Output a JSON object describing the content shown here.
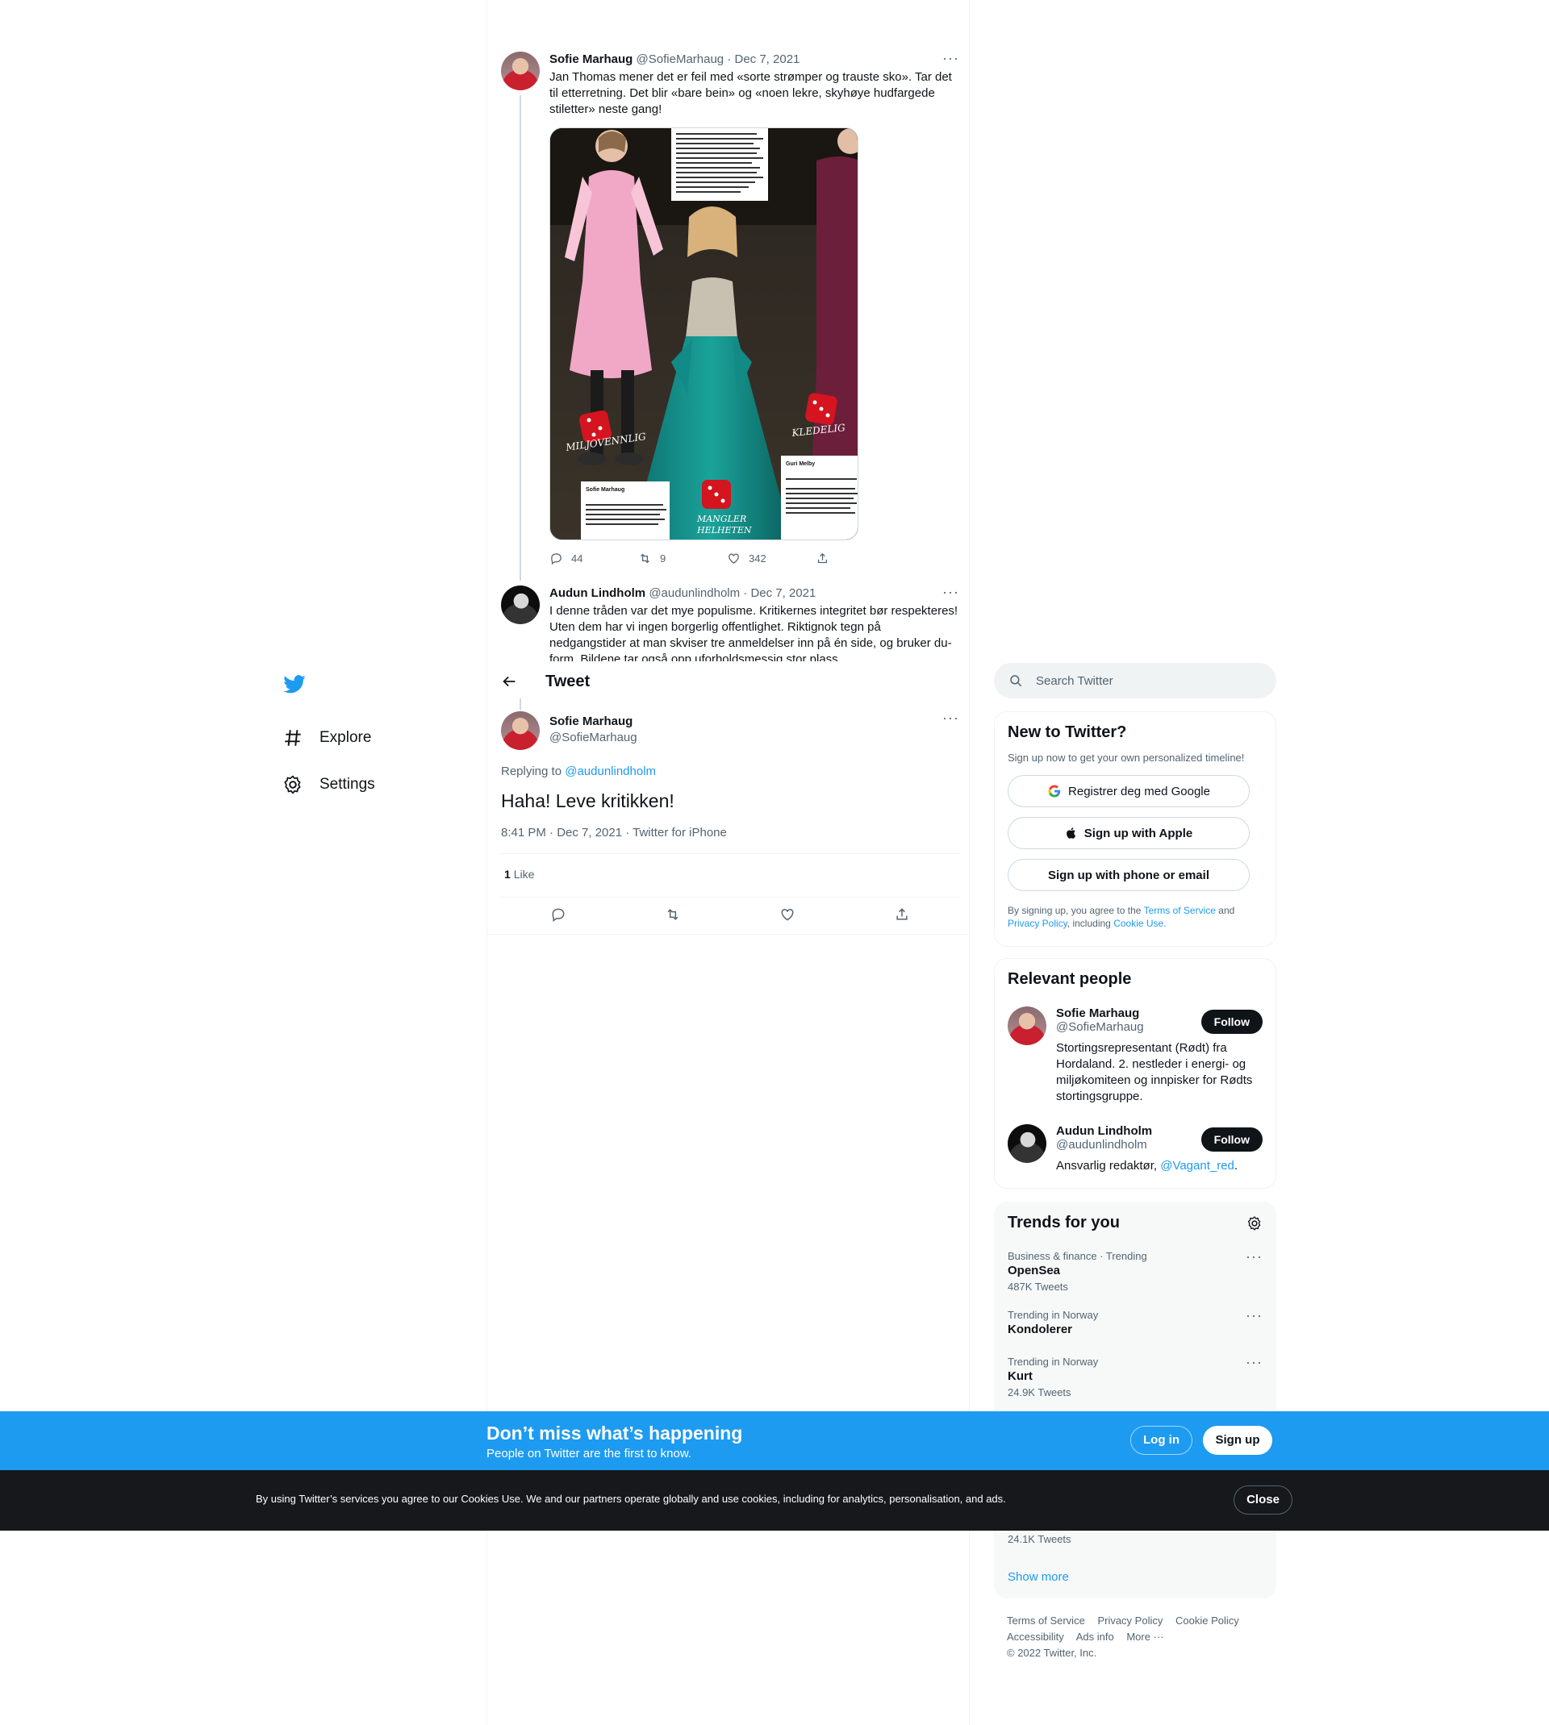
{
  "thread": {
    "tweet1": {
      "name": "Sofie Marhaug",
      "handle": "@SofieMarhaug",
      "date": "· Dec 7, 2021",
      "text": "Jan Thomas mener det er feil med «sorte strømper og trauste sko». Tar det til etterretning. Det blir «bare bein» og «noen lekre, skyhøye hudfargede stiletter» neste gang!",
      "replies": "44",
      "retweets": "9",
      "likes": "342",
      "media": {
        "box_text": "Dette er en litt underlig kjole. Den minner meg dessverre litt for mye om et kostyme. Den øvre delen ser nærmest ut som en BH, og så har du et skjørt nedentil. Det er ingen helhet i dette antrekket. Du er jo eventyrlig vakker, og du ville hatt utallige muligheter til å plukke et kledelig antrekk. Men denne kjolen holder ikke mål denne gangen.",
        "label_left": "MILJOVENNLIG",
        "label_right": "KLEDELIG",
        "label_center_1": "MANGLER",
        "label_center_2": "HELHETEN",
        "caption_left_name": "Sofie Marhaug",
        "caption_left_age": "(31)",
        "caption_left_party": "Rødt",
        "caption_left_outfit_label": "Antrekk:",
        "caption_left_outfit": "Ukjent",
        "caption_left_text": "Dette er en fantastisk kjole, og jeg elsker at du har kjøpt den på en vintagebutikk. Veldig miljøvennlig. Denne kjolen har potensial til å få",
        "caption_right_name": "Guri Melby",
        "caption_right_age": "(40)",
        "caption_right_party": "Venstre",
        "caption_right_outfit_label": "Antrekk:",
        "caption_right_outfit": "Kjole fra Jenny Packham hos Fjong",
        "caption_right_text": "Denne vinrøde kjolen er veldig kledelig på deg. Den sitter akkurat som den skal, og fargen er meget kledelig. Det er også utrolig fint med den lille pynten rundt halsen. Med ringen i midjen ved hjelp av et"
      }
    },
    "tweet2": {
      "name": "Audun Lindholm",
      "handle": "@audunlindholm",
      "date": "· Dec 7, 2021",
      "text": "I denne tråden var det mye populisme. Kritikernes integritet bør respekteres! Uten dem har vi ingen borgerlig offentlighet. Riktignok tegn på nedgangstider at man skviser tre anmeldelser inn på én side, og bruker du-form. Bildene tar også opp uforholdsmessig stor plass."
    }
  },
  "header": {
    "title": "Tweet"
  },
  "focus": {
    "name": "Sofie Marhaug",
    "handle": "@SofieMarhaug",
    "replying_label": "Replying to",
    "replying_handle": "@audunlindholm",
    "text": "Haha! Leve kritikken!",
    "meta": "8:41 PM · Dec 7, 2021 · Twitter for iPhone",
    "like_count": "1",
    "like_label": "Like"
  },
  "nav": {
    "items": [
      {
        "label": "Explore",
        "icon": "hashtag-icon"
      },
      {
        "label": "Settings",
        "icon": "gear-icon"
      }
    ]
  },
  "search": {
    "placeholder": "Search Twitter"
  },
  "signup_card": {
    "title": "New to Twitter?",
    "subtitle": "Sign up now to get your own personalized timeline!",
    "google": "Registrer deg med Google",
    "apple": "Sign up with Apple",
    "phone": "Sign up with phone or email",
    "legal_1": "By signing up, you agree to the",
    "legal_tos": "Terms of Service",
    "legal_2": "and",
    "legal_privacy": "Privacy Policy",
    "legal_3": ", including",
    "legal_cookie": "Cookie Use."
  },
  "relevant": {
    "title": "Relevant people",
    "people": [
      {
        "name": "Sofie Marhaug",
        "handle": "@SofieMarhaug",
        "bio": "Stortingsrepresentant (Rødt) fra Hordaland. 2. nestleder i energi- og miljøkomiteen og innpisker for Rødts stortingsgruppe.",
        "follow": "Follow"
      },
      {
        "name": "Audun Lindholm",
        "handle": "@audunlindholm",
        "bio": "Ansvarlig redaktør,",
        "bio_link": "@Vagant_red",
        "bio_end": ".",
        "follow": "Follow"
      }
    ]
  },
  "trends": {
    "title": "Trends for you",
    "items": [
      {
        "context": "Business & finance · Trending",
        "topic": "OpenSea",
        "count": "487K Tweets"
      },
      {
        "context": "Trending in Norway",
        "topic": "Kondolerer",
        "count": ""
      },
      {
        "context": "Trending in Norway",
        "topic": "Kurt",
        "count": "24.9K Tweets"
      }
    ],
    "hidden_count": "24.1K Tweets",
    "show_more": "Show more"
  },
  "footer": {
    "links": [
      "Terms of Service",
      "Privacy Policy",
      "Cookie Policy",
      "Accessibility",
      "Ads info",
      "More ···"
    ],
    "copyright": "© 2022 Twitter, Inc."
  },
  "banner": {
    "headline": "Don’t miss what’s happening",
    "sub": "People on Twitter are the first to know.",
    "login": "Log in",
    "signup": "Sign up"
  },
  "cookie": {
    "text": "By using Twitter’s services you agree to our Cookies Use. We and our partners operate globally and use cookies, including for analytics, personalisation, and ads.",
    "close": "Close"
  },
  "colors": {
    "accent": "#1d9bf0",
    "text": "#0f1419",
    "muted": "#536471",
    "cookie_bg": "#16181c"
  }
}
